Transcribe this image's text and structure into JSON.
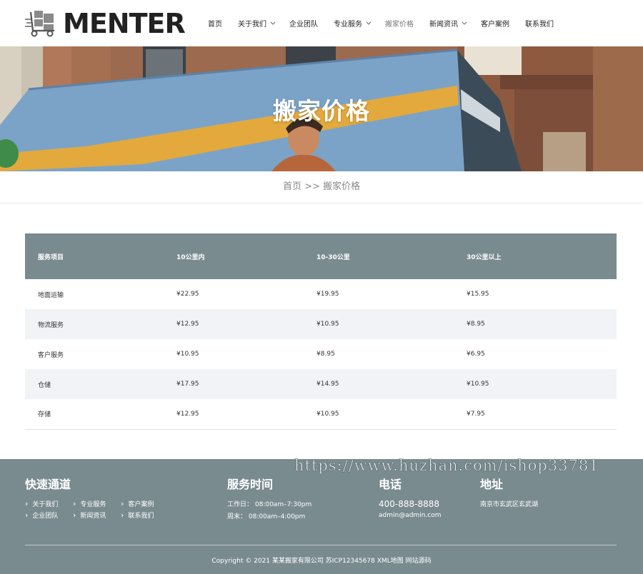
{
  "header": {
    "logo_text": "MENTER",
    "nav": [
      {
        "label": "首页",
        "dropdown": false,
        "active": false
      },
      {
        "label": "关于我们",
        "dropdown": true,
        "active": false
      },
      {
        "label": "企业团队",
        "dropdown": false,
        "active": false
      },
      {
        "label": "专业服务",
        "dropdown": true,
        "active": false
      },
      {
        "label": "搬家价格",
        "dropdown": false,
        "active": true
      },
      {
        "label": "新闻资讯",
        "dropdown": true,
        "active": false
      },
      {
        "label": "客户案例",
        "dropdown": false,
        "active": false
      },
      {
        "label": "联系我们",
        "dropdown": false,
        "active": false
      }
    ]
  },
  "banner": {
    "title": "搬家价格"
  },
  "breadcrumb": {
    "home": "首页",
    "separator": ">>",
    "current": "搬家价格"
  },
  "price_table": {
    "headers": [
      "服务项目",
      "10公里内",
      "10-30公里",
      "30公里以上"
    ],
    "rows": [
      [
        "地面运输",
        "¥22.95",
        "¥19.95",
        "¥15.95"
      ],
      [
        "物流服务",
        "¥12.95",
        "¥10.95",
        "¥8.95"
      ],
      [
        "客户服务",
        "¥10.95",
        "¥8.95",
        "¥6.95"
      ],
      [
        "仓储",
        "¥17.95",
        "¥14.95",
        "¥10.95"
      ],
      [
        "存储",
        "¥12.95",
        "¥10.95",
        "¥7.95"
      ]
    ]
  },
  "footer": {
    "quick": {
      "title": "快速通道",
      "links": [
        "关于我们",
        "专业服务",
        "客户案例",
        "企业团队",
        "新闻资讯",
        "联系我们"
      ]
    },
    "hours": {
      "title": "服务时间",
      "weekday": "工作日： 08:00am–7:30pm",
      "weekend": "周末： 08:00am–4:00pm"
    },
    "phone": {
      "title": "电话",
      "number": "400-888-8888",
      "email": "admin@admin.com"
    },
    "address": {
      "title": "地址",
      "text": "南京市玄武区玄武湖"
    },
    "copyright": "Copyright © 2021 某某搬家有限公司 苏ICP12345678",
    "xml_map": "XML地图",
    "source_link": "网站源码"
  },
  "watermark": "https://www.huzhan.com/ishop33781",
  "colors": {
    "table_header": "#7a8b90",
    "footer_bg": "#7a8b90",
    "row_alt": "#f2f3f7",
    "banner_truck": "#7ba3c8",
    "banner_stripe": "#e3a93c"
  }
}
